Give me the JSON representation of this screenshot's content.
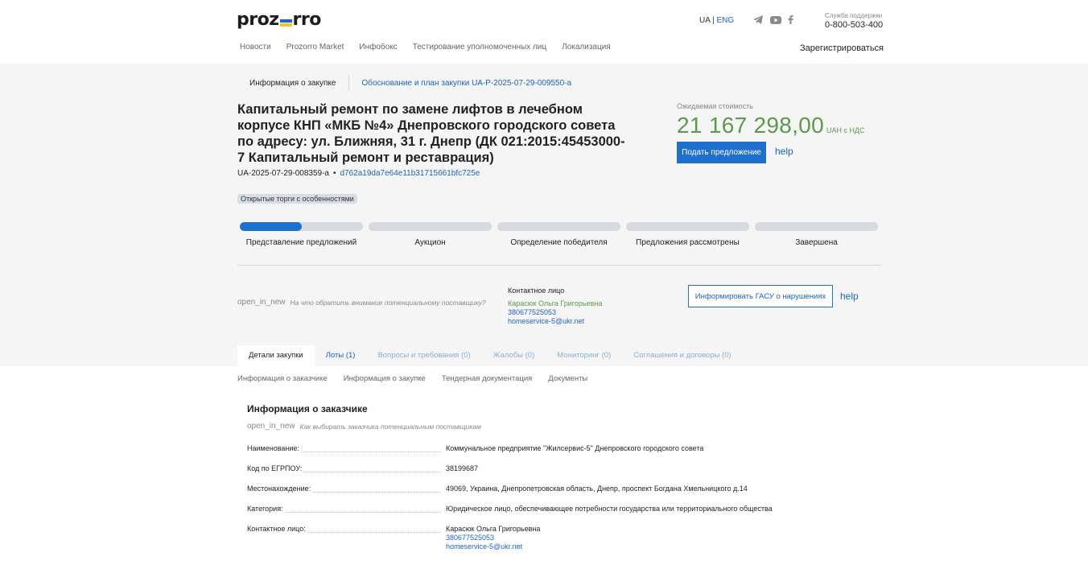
{
  "header": {
    "logo_left": "proz",
    "logo_right": "rro",
    "lang_ua": "UA",
    "lang_sep": "|",
    "lang_eng": "ENG",
    "social": [
      "telegram-icon",
      "youtube-icon",
      "facebook-icon"
    ],
    "support_label": "Служба поддержки",
    "support_phone": "0-800-503-400",
    "nav": [
      "Новости",
      "Prozorro Market",
      "Инфобокс",
      "Тестирование уполномоченных лиц",
      "Локализация"
    ],
    "register": "Зарегистрироваться"
  },
  "breadcrumbs": {
    "current": "Информация о закупке",
    "link": "Обоснование и план закупки UA-P-2025-07-29-009550-a"
  },
  "tender": {
    "title": "Капитальный ремонт по замене лифтов в лечебном корпусе КНП «МКБ №4» Днепровского городского совета по адресу: ул. Ближняя, 31 г. Днепр (ДК 021:2015:45453000-7 Капитальный ремонт и реставрация)",
    "id": "UA-2025-07-29-008359-a",
    "bullet": "•",
    "hash": "d762a19da7e64e11b31715661bfc725e",
    "badge": "Открытые торги с особенностями",
    "cost_label": "Ожидаемая стоимость",
    "cost": "21 167 298,00",
    "cost_unit": "UAH с НДС",
    "submit_button": "Подать предложение",
    "help": "help"
  },
  "stages": [
    {
      "label": "Представление предложений",
      "progress": 0.5
    },
    {
      "label": "Аукцион",
      "progress": 0
    },
    {
      "label": "Определение победителя",
      "progress": 0
    },
    {
      "label": "Предложения рассмотрены",
      "progress": 0
    },
    {
      "label": "Завершена",
      "progress": 0
    }
  ],
  "hint": {
    "icon": "open_in_new",
    "text": "На что обратить внимание потенциальному поставщику?"
  },
  "contact": {
    "heading": "Контактное лицо",
    "name": "Карасюк Ольга Григорьевна",
    "phone": "380677525053",
    "email": "homeservice-5@ukr.net"
  },
  "inform_button": "Информировать ГАСУ о нарушениях",
  "help2": "help",
  "tabs": [
    {
      "label": "Детали закупки"
    },
    {
      "label": "Лоты (1)"
    },
    {
      "label": "Вопросы и требования (0)"
    },
    {
      "label": "Жалобы (0)"
    },
    {
      "label": "Мониторинг (0)"
    },
    {
      "label": "Соглашения и договоры (0)"
    }
  ],
  "subtabs": [
    "Информация о заказчике",
    "Информация о закупке",
    "Тендерная документация",
    "Документы"
  ],
  "customer": {
    "title": "Информация о заказчике",
    "hint_icon": "open_in_new",
    "hint_text": "Как выбирать заказчика потенциальным поставщикам",
    "rows": [
      {
        "k": "Наименование:",
        "v": "Коммунальное предприятие \"Жилсервис-5\" Днепровского городского совета"
      },
      {
        "k": "Код по ЕГРПОУ:",
        "v": "38199687"
      },
      {
        "k": "Местонахождение:",
        "v": "49069, Украина, Днепропетровская область, Днепр, проспект Богдана Хмельницкого д.14"
      },
      {
        "k": "Категория:",
        "v": "Юридическое лицо, обеспечивающее потребности государства или территориального общества"
      },
      {
        "k": "Контактное лицо:",
        "v": "Карасюк Ольга Григорьевна",
        "phone": "380677525053",
        "email": "homeservice-5@ukr.net"
      }
    ]
  },
  "colors": {
    "accent": "#1f6fcc",
    "price": "#5a9a4a",
    "grey_bg": "#f5f5f5"
  }
}
